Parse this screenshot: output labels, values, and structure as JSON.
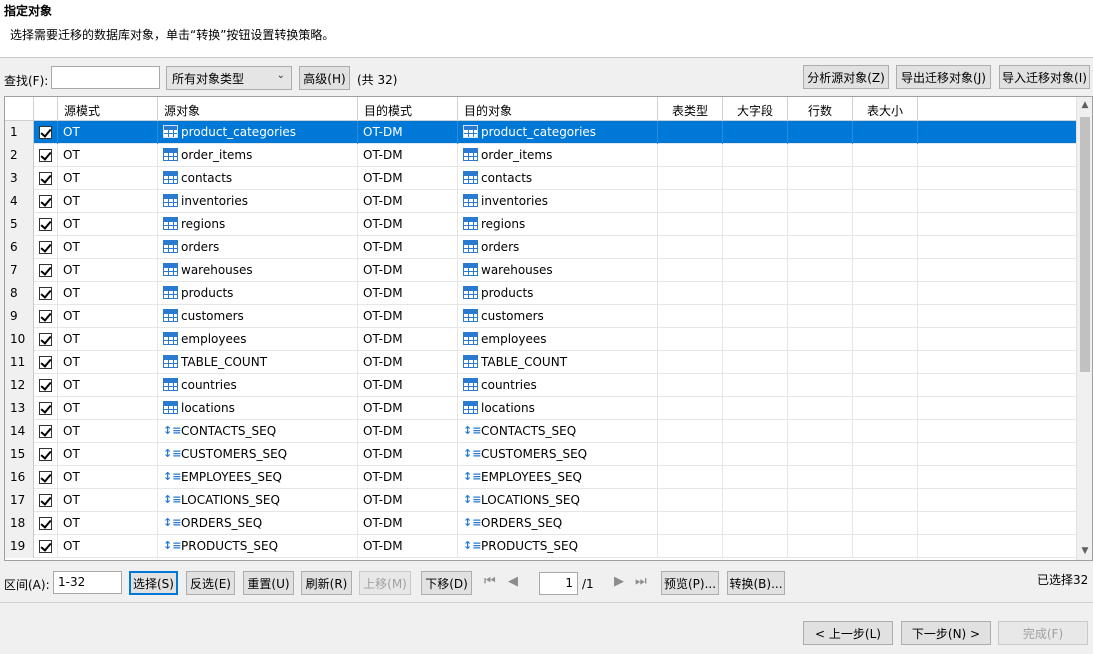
{
  "header": {
    "title": "指定对象",
    "subtitle": "选择需要迁移的数据库对象，单击“转换”按钮设置转换策略。"
  },
  "toolbar": {
    "find_label": "查找(F):",
    "find_value": "",
    "type_select": "所有对象类型",
    "advanced_label": "高级(H)",
    "count_label": "(共 32)",
    "analyze_label": "分析源对象(Z)",
    "export_label": "导出迁移对象(J)",
    "import_label": "导入迁移对象(I)"
  },
  "table": {
    "columns": [
      "源模式",
      "源对象",
      "目的模式",
      "目的对象",
      "表类型",
      "大字段",
      "行数",
      "表大小"
    ],
    "rows": [
      {
        "n": "1",
        "src_schema": "OT",
        "src_obj": "product_categories",
        "dst_schema": "OT-DM",
        "dst_obj": "product_categories",
        "kind": "table"
      },
      {
        "n": "2",
        "src_schema": "OT",
        "src_obj": "order_items",
        "dst_schema": "OT-DM",
        "dst_obj": "order_items",
        "kind": "table"
      },
      {
        "n": "3",
        "src_schema": "OT",
        "src_obj": "contacts",
        "dst_schema": "OT-DM",
        "dst_obj": "contacts",
        "kind": "table"
      },
      {
        "n": "4",
        "src_schema": "OT",
        "src_obj": "inventories",
        "dst_schema": "OT-DM",
        "dst_obj": "inventories",
        "kind": "table"
      },
      {
        "n": "5",
        "src_schema": "OT",
        "src_obj": "regions",
        "dst_schema": "OT-DM",
        "dst_obj": "regions",
        "kind": "table"
      },
      {
        "n": "6",
        "src_schema": "OT",
        "src_obj": "orders",
        "dst_schema": "OT-DM",
        "dst_obj": "orders",
        "kind": "table"
      },
      {
        "n": "7",
        "src_schema": "OT",
        "src_obj": "warehouses",
        "dst_schema": "OT-DM",
        "dst_obj": "warehouses",
        "kind": "table"
      },
      {
        "n": "8",
        "src_schema": "OT",
        "src_obj": "products",
        "dst_schema": "OT-DM",
        "dst_obj": "products",
        "kind": "table"
      },
      {
        "n": "9",
        "src_schema": "OT",
        "src_obj": "customers",
        "dst_schema": "OT-DM",
        "dst_obj": "customers",
        "kind": "table"
      },
      {
        "n": "10",
        "src_schema": "OT",
        "src_obj": "employees",
        "dst_schema": "OT-DM",
        "dst_obj": "employees",
        "kind": "table"
      },
      {
        "n": "11",
        "src_schema": "OT",
        "src_obj": "TABLE_COUNT",
        "dst_schema": "OT-DM",
        "dst_obj": "TABLE_COUNT",
        "kind": "table"
      },
      {
        "n": "12",
        "src_schema": "OT",
        "src_obj": "countries",
        "dst_schema": "OT-DM",
        "dst_obj": "countries",
        "kind": "table"
      },
      {
        "n": "13",
        "src_schema": "OT",
        "src_obj": "locations",
        "dst_schema": "OT-DM",
        "dst_obj": "locations",
        "kind": "table"
      },
      {
        "n": "14",
        "src_schema": "OT",
        "src_obj": "CONTACTS_SEQ",
        "dst_schema": "OT-DM",
        "dst_obj": "CONTACTS_SEQ",
        "kind": "sequence"
      },
      {
        "n": "15",
        "src_schema": "OT",
        "src_obj": "CUSTOMERS_SEQ",
        "dst_schema": "OT-DM",
        "dst_obj": "CUSTOMERS_SEQ",
        "kind": "sequence"
      },
      {
        "n": "16",
        "src_schema": "OT",
        "src_obj": "EMPLOYEES_SEQ",
        "dst_schema": "OT-DM",
        "dst_obj": "EMPLOYEES_SEQ",
        "kind": "sequence"
      },
      {
        "n": "17",
        "src_schema": "OT",
        "src_obj": "LOCATIONS_SEQ",
        "dst_schema": "OT-DM",
        "dst_obj": "LOCATIONS_SEQ",
        "kind": "sequence"
      },
      {
        "n": "18",
        "src_schema": "OT",
        "src_obj": "ORDERS_SEQ",
        "dst_schema": "OT-DM",
        "dst_obj": "ORDERS_SEQ",
        "kind": "sequence"
      },
      {
        "n": "19",
        "src_schema": "OT",
        "src_obj": "PRODUCTS_SEQ",
        "dst_schema": "OT-DM",
        "dst_obj": "PRODUCTS_SEQ",
        "kind": "sequence"
      }
    ],
    "selected_row": "1"
  },
  "pager": {
    "range_label": "区间(A):",
    "range_value": "1-32",
    "select_label": "选择(S)",
    "invert_label": "反选(E)",
    "reset_label": "重置(U)",
    "refresh_label": "刷新(R)",
    "up_label": "上移(M)",
    "down_label": "下移(D)",
    "page_value": "1",
    "page_total": "/1",
    "preview_label": "预览(P)...",
    "convert_label": "转换(B)...",
    "selected_count": "已选择32"
  },
  "footer": {
    "prev_label": "< 上一步(L)",
    "next_label": "下一步(N) >",
    "finish_label": "完成(F)"
  },
  "colors": {
    "selection": "#0078d7",
    "icon_blue": "#2a7bd0"
  }
}
